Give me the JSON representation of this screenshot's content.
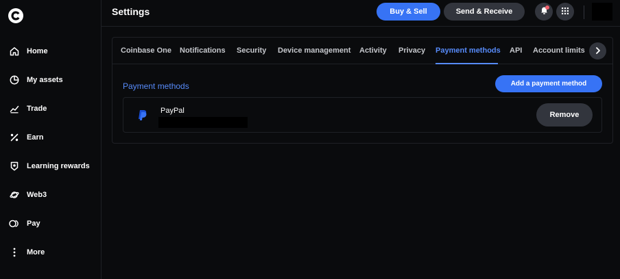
{
  "sidebar": {
    "logo_icon": "coinbase-logo",
    "items": [
      {
        "label": "Home",
        "icon": "home-icon"
      },
      {
        "label": "My assets",
        "icon": "pie-chart-icon"
      },
      {
        "label": "Trade",
        "icon": "trend-chart-icon"
      },
      {
        "label": "Earn",
        "icon": "percent-icon"
      },
      {
        "label": "Learning rewards",
        "icon": "reward-badge-icon"
      },
      {
        "label": "Web3",
        "icon": "planet-icon"
      },
      {
        "label": "Pay",
        "icon": "pay-icon"
      },
      {
        "label": "More",
        "icon": "more-vertical-icon"
      }
    ]
  },
  "header": {
    "title": "Settings",
    "buy_sell_label": "Buy & Sell",
    "send_receive_label": "Send & Receive",
    "notifications_icon": "bell-icon",
    "apps_icon": "grid-icon"
  },
  "tabs": {
    "items": [
      {
        "label": "Coinbase One"
      },
      {
        "label": "Notifications"
      },
      {
        "label": "Security"
      },
      {
        "label": "Device management"
      },
      {
        "label": "Activity"
      },
      {
        "label": "Privacy"
      },
      {
        "label": "Payment methods"
      },
      {
        "label": "API"
      },
      {
        "label": "Account limits"
      }
    ],
    "active_index": 6
  },
  "payment_methods": {
    "section_title": "Payment methods",
    "add_button_label": "Add a payment method",
    "methods": [
      {
        "name": "PayPal",
        "icon": "paypal-icon",
        "remove_label": "Remove"
      }
    ]
  },
  "colors": {
    "accent": "#3773f5",
    "accent_text": "#578bfa",
    "background": "#0a0b0d",
    "button_secondary": "#32353d",
    "notification_dot": "#f0616d"
  }
}
